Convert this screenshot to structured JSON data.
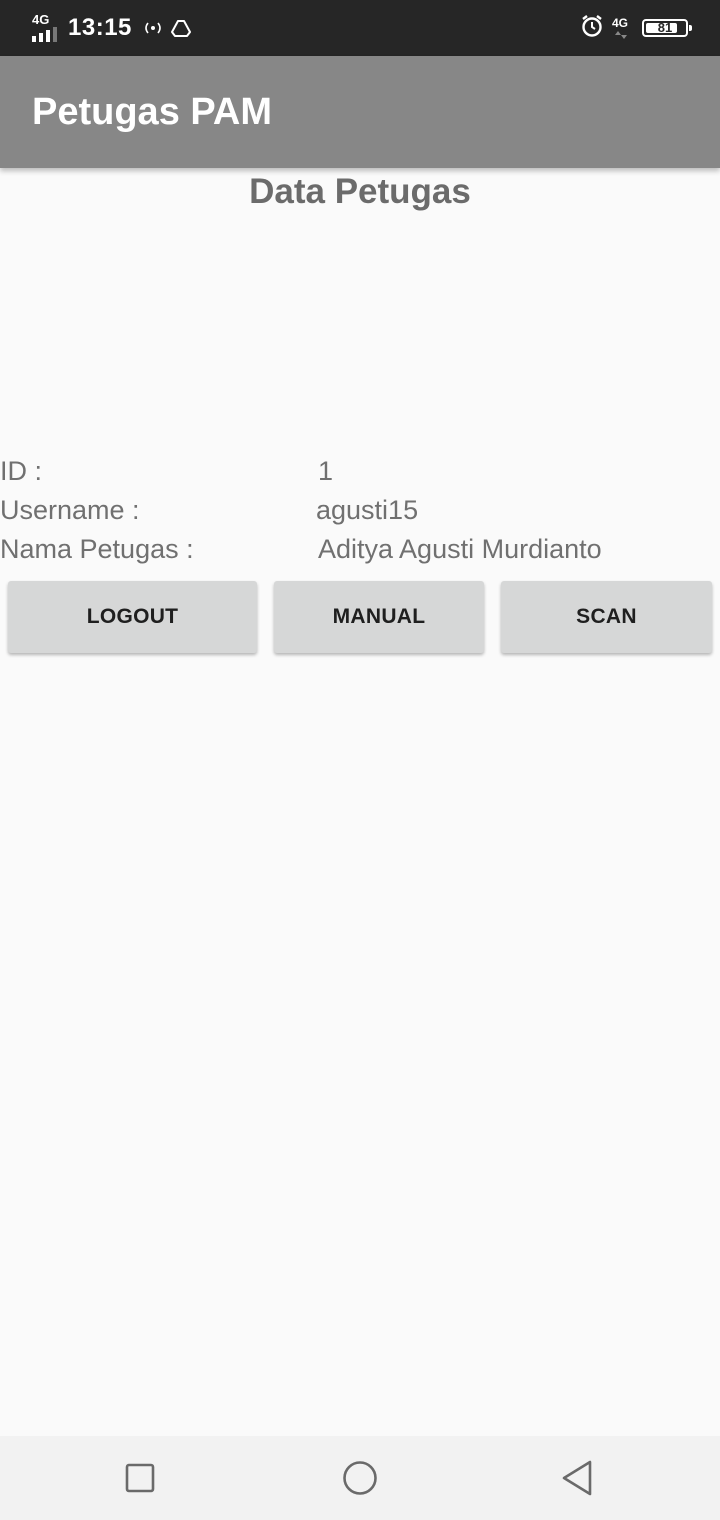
{
  "status_bar": {
    "network_left": "4G",
    "time": "13:15",
    "network_right": "4G",
    "battery": "81",
    "battery_level": 0.81,
    "icons": [
      "signal-icon",
      "hotspot-icon",
      "drive-icon",
      "alarm-icon",
      "mobile-data-icon",
      "battery-icon"
    ]
  },
  "app_bar": {
    "title": "Petugas PAM"
  },
  "heading": "Data Petugas",
  "info": {
    "id_label": "ID :",
    "id_value": "1",
    "username_label": "Username :",
    "username_value": "agusti15",
    "name_label": "Nama Petugas :",
    "name_value": "Aditya Agusti Murdianto"
  },
  "buttons": {
    "logout": "LOGOUT",
    "manual": "MANUAL",
    "scan": "SCAN"
  },
  "nav_bar": {
    "icons": [
      "recents-icon",
      "home-icon",
      "back-icon"
    ]
  },
  "colors": {
    "status_bar": "#262626",
    "app_bar": "#878787",
    "background": "#fafafa",
    "button": "#d6d7d7",
    "text_gray": "#707070"
  }
}
